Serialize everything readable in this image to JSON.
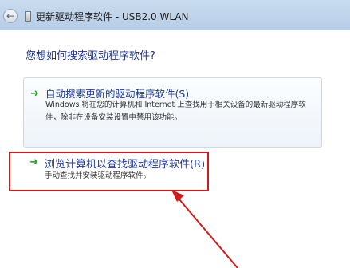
{
  "window": {
    "title": "更新驱动程序软件 - USB2.0 WLAN"
  },
  "main": {
    "question": "您想如何搜索驱动程序软件?",
    "options": [
      {
        "title": "自动搜索更新的驱动程序软件(S)",
        "description": "Windows 将在您的计算机和 Internet 上查找用于相关设备的最新驱动程序软件，除非在设备安装设置中禁用该功能。"
      },
      {
        "title": "浏览计算机以查找驱动程序软件(R)",
        "description": "手动查找并安装驱动程序软件。"
      }
    ]
  },
  "annotation": {
    "color": "#d11a1a"
  }
}
